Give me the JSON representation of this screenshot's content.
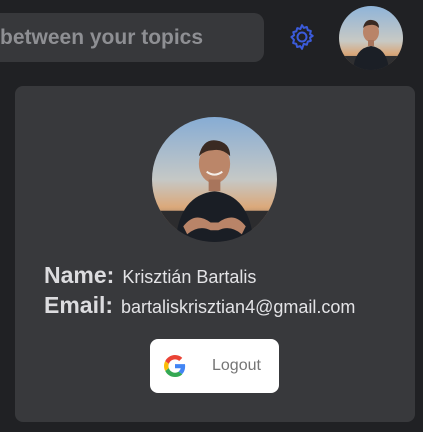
{
  "header": {
    "search_text": "between your topics",
    "settings_icon": "gear-icon",
    "accent_color": "#3b5bdb"
  },
  "profile": {
    "name_label": "Name:",
    "name_value": "Krisztián Bartalis",
    "email_label": "Email:",
    "email_value": "bartaliskrisztian4@gmail.com"
  },
  "logout": {
    "label": "Logout",
    "icon": "google-icon"
  }
}
